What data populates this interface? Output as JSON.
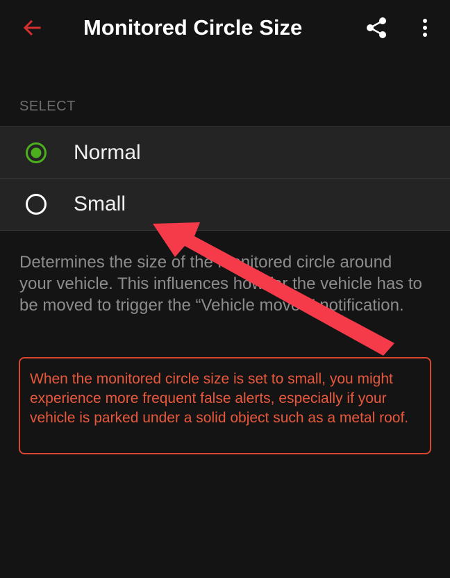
{
  "header": {
    "title": "Monitored Circle Size",
    "back_icon": "arrow-left-icon",
    "share_icon": "share-icon",
    "more_icon": "more-vertical-icon"
  },
  "section": {
    "label": "SELECT"
  },
  "options": [
    {
      "label": "Normal",
      "selected": true
    },
    {
      "label": "Small",
      "selected": false
    }
  ],
  "description": "Determines the size of the monitored circle around your vehicle. This influences how far the vehicle has to be moved to trigger the “Vehicle moved” notification.",
  "warning": "When the monitored circle size is set to small, you might experience more frequent false alerts, especially if your vehicle is parked under a solid object such as a metal roof.",
  "colors": {
    "background": "#141414",
    "accent_back": "#d32f2f",
    "radio_selected": "#4caf1e",
    "warning": "#e8583c",
    "annotation_arrow": "#f53b4a"
  }
}
